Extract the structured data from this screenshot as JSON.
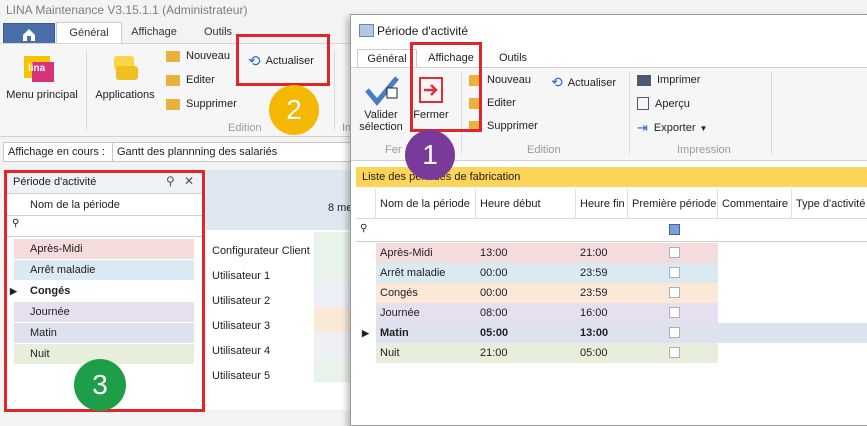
{
  "main": {
    "title": "LINA Maintenance  V3.15.1.1  (Administrateur)",
    "tabs": [
      "Général",
      "Affichage",
      "Outils"
    ],
    "buttons": {
      "menu_principal": "Menu principal",
      "applications": "Applications",
      "nouveau": "Nouveau",
      "editer": "Editer",
      "supprimer": "Supprimer",
      "actualiser": "Actualiser"
    },
    "group_edition": "Edition",
    "group_partial": "In",
    "affichage_label": "Affichage en cours :",
    "affichage_value": "Gantt des plannning des salariés"
  },
  "left_panel": {
    "title": "Période d'activité",
    "column": "Nom de la période",
    "rows": [
      {
        "label": "Après-Midi",
        "color": "#f5dcdc"
      },
      {
        "label": "Arrêt maladie",
        "color": "#dbe9f2"
      },
      {
        "label": "Congés",
        "color": "#ffffff"
      },
      {
        "label": "Journée",
        "color": "#e6dff0"
      },
      {
        "label": "Matin",
        "color": "#dde3ee"
      },
      {
        "label": "Nuit",
        "color": "#e7efdc"
      }
    ],
    "selected": "Congés"
  },
  "gantt": {
    "header": "8 me",
    "rows": [
      "Configurateur Client",
      "Utilisateur 1",
      "Utilisateur 2",
      "Utilisateur 3",
      "Utilisateur 4",
      "Utilisateur 5"
    ]
  },
  "dialog": {
    "title": "Période d'activité",
    "tabs": [
      "Général",
      "Affichage",
      "Outils"
    ],
    "buttons": {
      "valider": "Valider\nsélection",
      "fermer": "Fermer",
      "nouveau": "Nouveau",
      "actualiser": "Actualiser",
      "editer": "Editer",
      "supprimer": "Supprimer",
      "imprimer": "Imprimer",
      "apercu": "Aperçu",
      "exporter": "Exporter"
    },
    "groups": {
      "fermer": "Fer",
      "edition": "Edition",
      "impression": "Impression"
    },
    "list_title": "Liste des périodes de fabrication",
    "columns": [
      "Nom de la période",
      "Heure début",
      "Heure fin",
      "Première période",
      "Commentaire",
      "Type d'activité"
    ],
    "rows": [
      {
        "nom": "Après-Midi",
        "debut": "13:00",
        "fin": "21:00",
        "color": "#f5dcdc"
      },
      {
        "nom": "Arrêt maladie",
        "debut": "00:00",
        "fin": "23:59",
        "color": "#dbe9f2"
      },
      {
        "nom": "Congés",
        "debut": "00:00",
        "fin": "23:59",
        "color": "#fce8d6"
      },
      {
        "nom": "Journée",
        "debut": "08:00",
        "fin": "16:00",
        "color": "#e6dff0"
      },
      {
        "nom": "Matin",
        "debut": "05:00",
        "fin": "13:00",
        "color": "#dde3ee"
      },
      {
        "nom": "Nuit",
        "debut": "21:00",
        "fin": "05:00",
        "color": "#e7efdc"
      }
    ],
    "selected": "Matin"
  },
  "callouts": [
    {
      "number": "1",
      "color": "#7a3a9a"
    },
    {
      "number": "2",
      "color": "#f5b800"
    },
    {
      "number": "3",
      "color": "#1f9e4a"
    }
  ]
}
